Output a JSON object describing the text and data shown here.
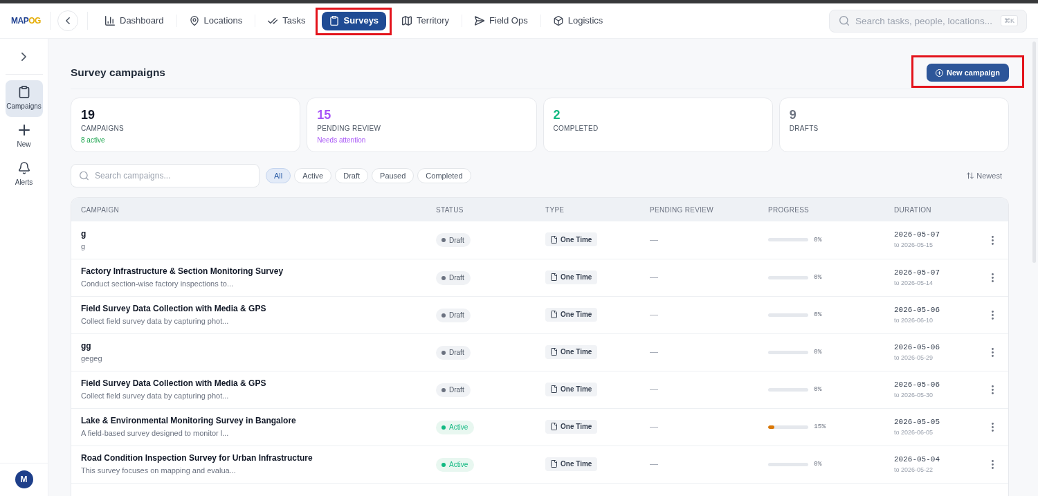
{
  "app": {
    "logo": [
      "MAP",
      "OG"
    ]
  },
  "nav": [
    {
      "label": "Dashboard",
      "selected": false,
      "highlighted": false
    },
    {
      "label": "Locations",
      "selected": false,
      "highlighted": false
    },
    {
      "label": "Tasks",
      "selected": false,
      "highlighted": false
    },
    {
      "label": "Surveys",
      "selected": true,
      "highlighted": true
    },
    {
      "label": "Territory",
      "selected": false,
      "highlighted": false
    },
    {
      "label": "Field Ops",
      "selected": false,
      "highlighted": false
    },
    {
      "label": "Logistics",
      "selected": false,
      "highlighted": false
    }
  ],
  "search": {
    "placeholder": "Search tasks, people, locations...",
    "shortcut": "⌘K"
  },
  "sidebar": {
    "items": [
      {
        "label": "Campaigns",
        "selected": true
      },
      {
        "label": "New",
        "selected": false
      },
      {
        "label": "Alerts",
        "selected": false
      }
    ],
    "user_initial": "M"
  },
  "page": {
    "title": "Survey campaigns",
    "new_button": {
      "label": "New campaign",
      "highlighted": true
    }
  },
  "stats": [
    {
      "kind": "total",
      "value": "19",
      "label": "CAMPAIGNS",
      "note": "8 active"
    },
    {
      "kind": "pending",
      "value": "15",
      "label": "PENDING REVIEW",
      "note": "Needs attention"
    },
    {
      "kind": "completed",
      "value": "2",
      "label": "COMPLETED"
    },
    {
      "kind": "drafts",
      "value": "9",
      "label": "DRAFTS"
    }
  ],
  "filters": {
    "search_placeholder": "Search campaigns...",
    "chips": [
      {
        "label": "All",
        "selected": true
      },
      {
        "label": "Active",
        "selected": false
      },
      {
        "label": "Draft",
        "selected": false
      },
      {
        "label": "Paused",
        "selected": false
      },
      {
        "label": "Completed",
        "selected": false
      }
    ],
    "sort": "Newest"
  },
  "table": {
    "columns": [
      "CAMPAIGN",
      "STATUS",
      "TYPE",
      "PENDING REVIEW",
      "PROGRESS",
      "DURATION"
    ],
    "rows": [
      {
        "title": "g",
        "description": "g",
        "status": {
          "label": "Draft",
          "kind": "draft"
        },
        "type": "One Time",
        "pending_review": "—",
        "progress": {
          "level": 0,
          "reading": "0%"
        },
        "start": "2026-05-07",
        "end": "to 2026-05-15"
      },
      {
        "title": "Factory Infrastructure & Section Monitoring Survey",
        "description": "Conduct section-wise factory inspections to...",
        "status": {
          "label": "Draft",
          "kind": "draft"
        },
        "type": "One Time",
        "pending_review": "—",
        "progress": {
          "level": 0,
          "reading": "0%"
        },
        "start": "2026-05-07",
        "end": "to 2026-05-14"
      },
      {
        "title": "Field Survey Data Collection with Media & GPS",
        "description": "Collect field survey data by capturing phot...",
        "status": {
          "label": "Draft",
          "kind": "draft"
        },
        "type": "One Time",
        "pending_review": "—",
        "progress": {
          "level": 0,
          "reading": "0%"
        },
        "start": "2026-05-06",
        "end": "to 2026-06-10"
      },
      {
        "title": "gg",
        "description": "gegeg",
        "status": {
          "label": "Draft",
          "kind": "draft"
        },
        "type": "One Time",
        "pending_review": "—",
        "progress": {
          "level": 0,
          "reading": "0%"
        },
        "start": "2026-05-06",
        "end": "to 2026-05-29"
      },
      {
        "title": "Field Survey Data Collection with Media & GPS",
        "description": "Collect field survey data by capturing phot...",
        "status": {
          "label": "Draft",
          "kind": "draft"
        },
        "type": "One Time",
        "pending_review": "—",
        "progress": {
          "level": 0,
          "reading": "0%"
        },
        "start": "2026-05-06",
        "end": "to 2026-05-30"
      },
      {
        "title": "Lake & Environmental Monitoring Survey in Bangalore",
        "description": "A field-based survey designed to monitor l...",
        "status": {
          "label": "Active",
          "kind": "active"
        },
        "type": "One Time",
        "pending_review": "—",
        "progress": {
          "level": 0.15,
          "reading": "15%"
        },
        "start": "2026-05-05",
        "end": "to 2026-06-05"
      },
      {
        "title": "Road Condition Inspection Survey for Urban Infrastructure",
        "description": "This survey focuses on mapping and evalua...",
        "status": {
          "label": "Active",
          "kind": "active"
        },
        "type": "One Time",
        "pending_review": "—",
        "progress": {
          "level": 0,
          "reading": "0%"
        },
        "start": "2026-05-04",
        "end": "to 2026-05-22"
      }
    ]
  }
}
